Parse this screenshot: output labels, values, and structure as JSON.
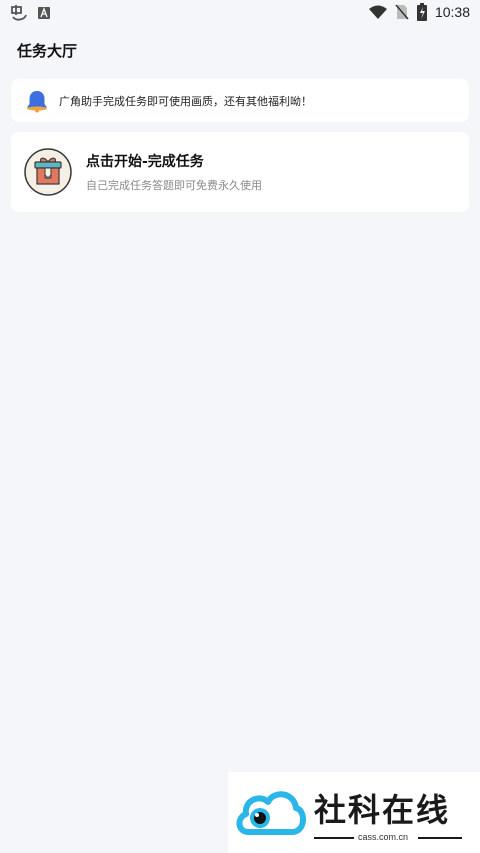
{
  "status_bar": {
    "time": "10:38",
    "left_icons": [
      "app-logo-icon",
      "a-letter-icon"
    ],
    "right_icons": [
      "wifi-icon",
      "no-sim-icon",
      "battery-charging-icon"
    ]
  },
  "page": {
    "title": "任务大厅"
  },
  "notice": {
    "icon": "bell-icon",
    "text": "广角助手完成任务即可使用画质，还有其他福利呦！"
  },
  "task": {
    "icon": "gift-box-icon",
    "title": "点击开始-完成任务",
    "subtitle": "自己完成任务答题即可免费永久使用"
  },
  "watermark": {
    "title": "社科在线",
    "domain": "cass.com.cn"
  },
  "colors": {
    "background": "#f5f6fa",
    "card": "#ffffff",
    "bell_blue": "#3d6fe0",
    "gift_accent": "#e07a5f",
    "subtitle_gray": "#8a8a8a",
    "logo_blue": "#2bb6e8"
  }
}
